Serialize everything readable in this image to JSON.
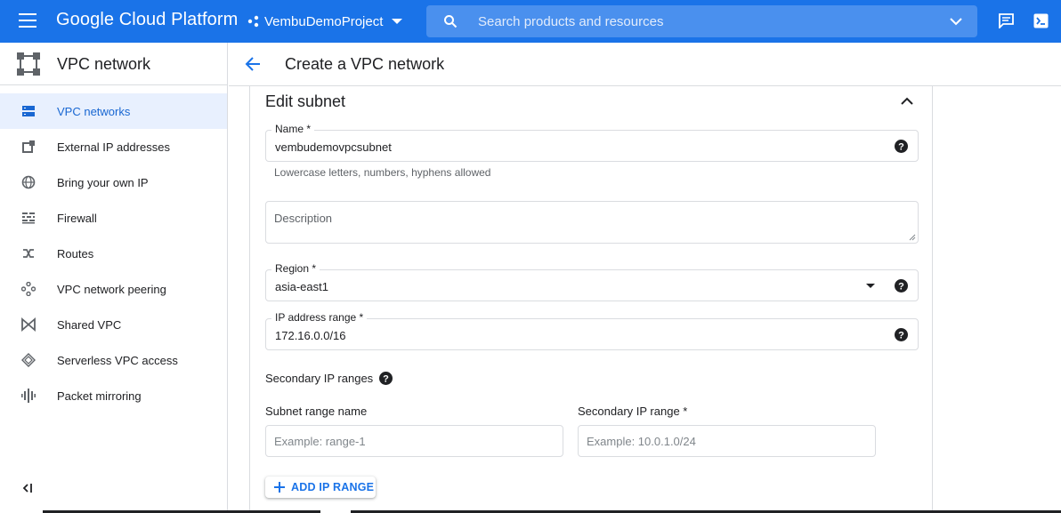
{
  "topbar": {
    "brand": "Google Cloud Platform",
    "project": "VembuDemoProject",
    "search_placeholder": "Search products and resources",
    "color": "#1a73e8"
  },
  "sidebar": {
    "title": "VPC network",
    "items": [
      {
        "label": "VPC networks",
        "icon": "vpc-networks-icon",
        "active": true
      },
      {
        "label": "External IP addresses",
        "icon": "external-ip-icon"
      },
      {
        "label": "Bring your own IP",
        "icon": "globe-icon"
      },
      {
        "label": "Firewall",
        "icon": "firewall-icon"
      },
      {
        "label": "Routes",
        "icon": "routes-icon"
      },
      {
        "label": "VPC network peering",
        "icon": "peering-icon"
      },
      {
        "label": "Shared VPC",
        "icon": "shared-vpc-icon"
      },
      {
        "label": "Serverless VPC access",
        "icon": "serverless-icon"
      },
      {
        "label": "Packet mirroring",
        "icon": "packet-mirroring-icon"
      }
    ]
  },
  "header": {
    "title": "Create a VPC network"
  },
  "form": {
    "section_title": "Edit subnet",
    "name": {
      "label": "Name *",
      "value": "vembudemovpcsubnet",
      "hint": "Lowercase letters, numbers, hyphens allowed"
    },
    "description": {
      "placeholder": "Description"
    },
    "region": {
      "label": "Region *",
      "value": "asia-east1"
    },
    "ip_range": {
      "label": "IP address range *",
      "value": "172.16.0.0/16"
    },
    "secondary": {
      "title": "Secondary IP ranges",
      "subnet_range_name_label": "Subnet range name",
      "subnet_range_name_placeholder": "Example: range-1",
      "secondary_range_label": "Secondary IP range *",
      "secondary_range_placeholder": "Example: 10.0.1.0/24"
    },
    "add_button": "ADD IP RANGE"
  }
}
